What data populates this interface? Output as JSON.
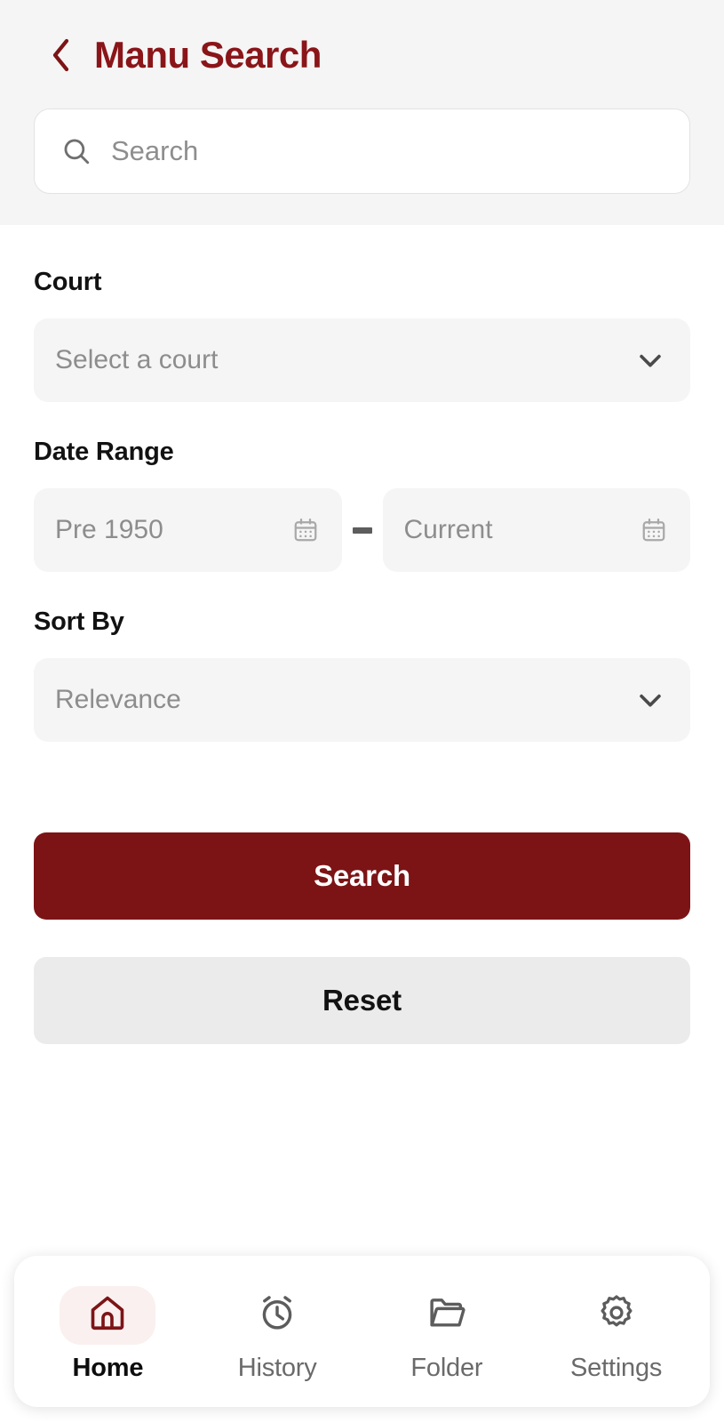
{
  "header": {
    "back_icon": "chevron-left-icon",
    "title": "Manu Search",
    "search": {
      "icon": "search-icon",
      "value": "",
      "placeholder": "Search"
    }
  },
  "form": {
    "court": {
      "label": "Court",
      "value": "Select a court",
      "chevron_icon": "chevron-down-icon"
    },
    "date_range": {
      "label": "Date Range",
      "from": {
        "value": "Pre 1950",
        "icon": "calendar-icon"
      },
      "separator": "-",
      "to": {
        "value": "Current",
        "icon": "calendar-icon"
      }
    },
    "sort_by": {
      "label": "Sort By",
      "value": "Relevance",
      "chevron_icon": "chevron-down-icon"
    },
    "search_button": "Search",
    "reset_button": "Reset"
  },
  "bottom_nav": {
    "items": [
      {
        "label": "Home",
        "icon": "home-icon",
        "active": true
      },
      {
        "label": "History",
        "icon": "alarm-clock-icon",
        "active": false
      },
      {
        "label": "Folder",
        "icon": "folder-icon",
        "active": false
      },
      {
        "label": "Settings",
        "icon": "gear-icon",
        "active": false
      }
    ]
  },
  "colors": {
    "brand_maroon": "#7c1416",
    "title_maroon": "#8a1519",
    "header_bg": "#f5f5f5",
    "field_bg": "#f5f5f5",
    "reset_bg": "#ebebeb",
    "active_pill": "#faf0f0",
    "placeholder_gray": "#8d8d8d"
  }
}
